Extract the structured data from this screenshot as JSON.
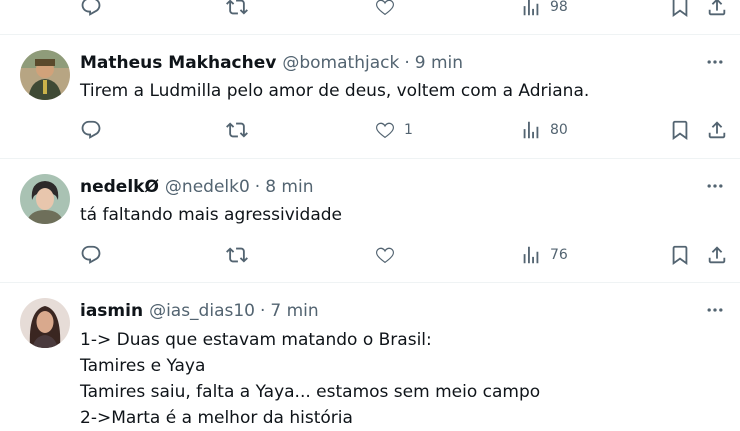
{
  "top_actions": {
    "views": "98"
  },
  "tweets": [
    {
      "name": "Matheus Makhachev",
      "handle": "@bomathjack",
      "separator": "·",
      "time": "9 min",
      "lines": [
        "Tirem a Ludmilla pelo amor de deus, voltem com a Adriana."
      ],
      "likes": "1",
      "views": "80"
    },
    {
      "name": "nedelkØ",
      "handle": "@nedelk0",
      "separator": "·",
      "time": "8 min",
      "lines": [
        "tá faltando mais agressividade"
      ],
      "likes": "",
      "views": "76"
    },
    {
      "name": "iasmin",
      "handle": "@ias_dias10",
      "separator": "·",
      "time": "7 min",
      "lines": [
        "1-> Duas que estavam matando o Brasil:",
        "Tamires e Yaya",
        "Tamires saiu, falta a Yaya... estamos sem meio campo",
        "2->Marta é a melhor da história"
      ]
    }
  ],
  "icons": {
    "reply": "reply-icon",
    "retweet": "retweet-icon",
    "like": "like-icon",
    "views": "views-icon",
    "bookmark": "bookmark-icon",
    "share": "share-icon",
    "more": "more-icon"
  },
  "colors": {
    "text": "#0f1419",
    "secondary": "#536471",
    "divider": "#eff3f4"
  }
}
